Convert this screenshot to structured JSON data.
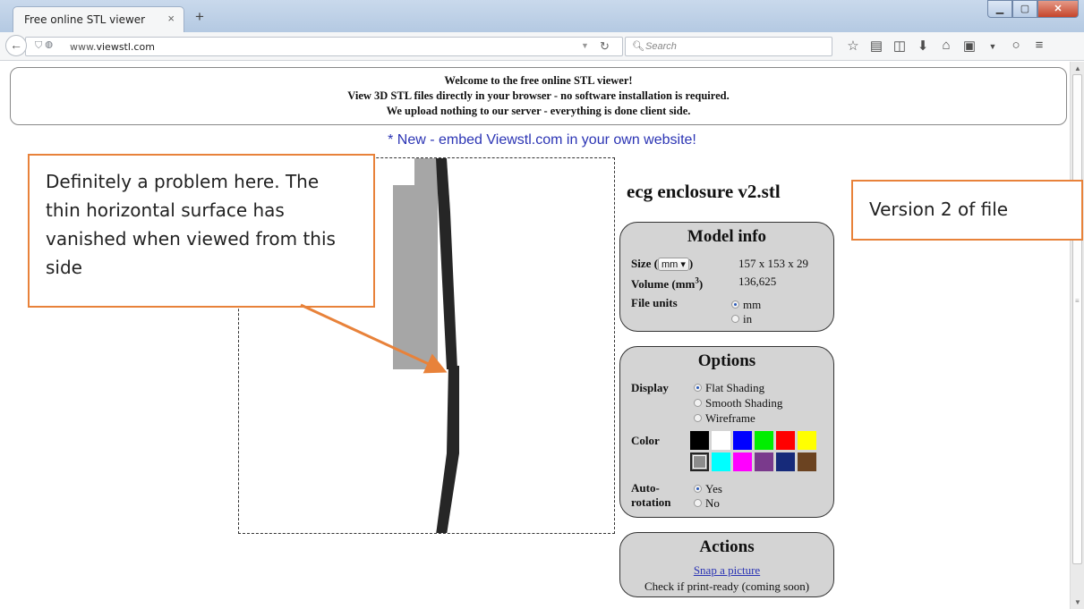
{
  "browser": {
    "tab_title": "Free online STL viewer",
    "tab_close": "×",
    "new_tab": "+",
    "url_prefix": "www.",
    "url_domain": "viewstl.com",
    "search_placeholder": "Search",
    "window_controls": [
      "minimize",
      "maximize",
      "close"
    ]
  },
  "banner": {
    "line1": "Welcome to the free online STL viewer!",
    "line2": "View 3D STL files directly in your browser - no software installation is required.",
    "line3": "We upload nothing to our server - everything is done client side."
  },
  "embed_link": "* New - embed Viewstl.com in your own website!",
  "filename": "ecg enclosure v2.stl",
  "model_info": {
    "title": "Model info",
    "size_label": "Size (",
    "size_unit": "mm",
    "size_close": ")",
    "size_value": "157 x 153 x 29",
    "volume_label": "Volume (mm",
    "volume_sup": "3",
    "volume_close": ")",
    "volume_value": "136,625",
    "file_units_label": "File units",
    "unit_options": [
      "mm",
      "in"
    ],
    "unit_selected": "mm"
  },
  "options": {
    "title": "Options",
    "display_label": "Display",
    "display_options": [
      "Flat Shading",
      "Smooth Shading",
      "Wireframe"
    ],
    "display_selected": "Flat Shading",
    "color_label": "Color",
    "colors_row1": [
      "#000000",
      "#ffffff",
      "#0000ff",
      "#00ee00",
      "#ff0000",
      "#ffff00"
    ],
    "colors_row2": [
      "#8c8c8c",
      "#00ffff",
      "#ff00ff",
      "#7a3a8c",
      "#162a7a",
      "#6b4321"
    ],
    "color_selected": "#8c8c8c",
    "autorotation_label1": "Auto-",
    "autorotation_label2": "rotation",
    "autorotation_options": [
      "Yes",
      "No"
    ],
    "autorotation_selected": "Yes"
  },
  "actions": {
    "title": "Actions",
    "snap_label": "Snap a picture",
    "ready_label": "Check if print-ready (coming soon)"
  },
  "callouts": {
    "left_text": "Definitely a problem here. The thin horizontal surface has vanished when viewed from this side",
    "right_text": "Version 2 of file"
  }
}
